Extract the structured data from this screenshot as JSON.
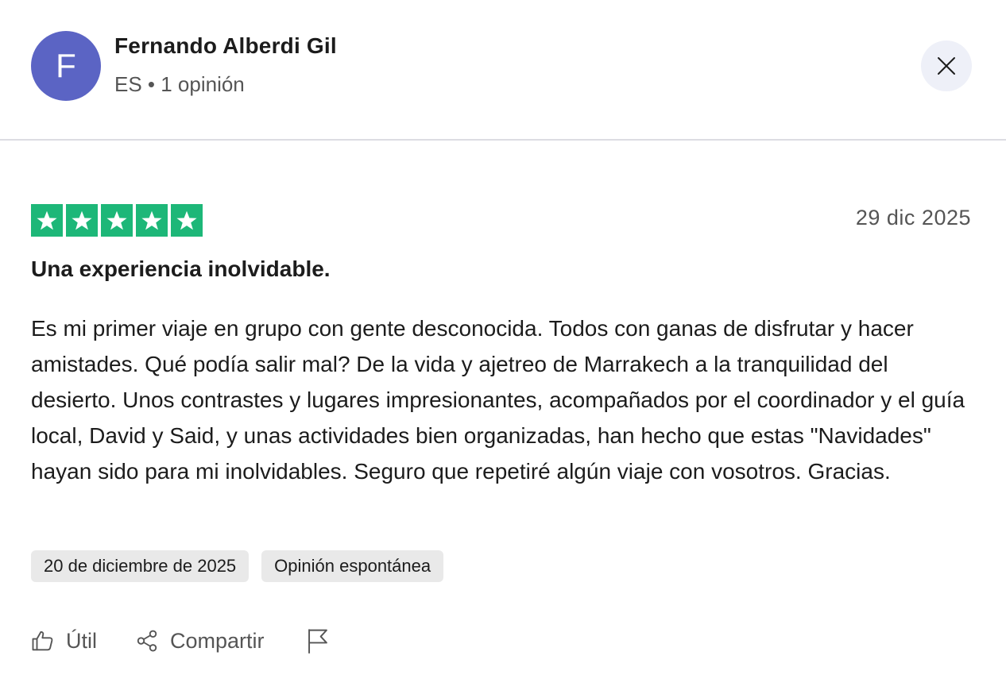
{
  "reviewer": {
    "initial": "F",
    "name": "Fernando Alberdi Gil",
    "meta": "ES • 1 opinión",
    "avatar_color": "#5b64c4"
  },
  "close_icon": "close-icon",
  "review": {
    "rating": 5,
    "max_rating": 5,
    "star_color": "#1db778",
    "date": "29 dic 2025",
    "title": "Una experiencia inolvidable.",
    "body": "Es mi primer viaje en grupo con gente desconocida. Todos con ganas de disfrutar y hacer amistades. Qué podía salir mal? De la vida y ajetreo de Marrakech a la tranquilidad del desierto. Unos contrastes y lugares impresionantes, acompañados por el coordinador y el guía local, David y Said, y unas actividades bien organizadas, han hecho que estas \"Navidades\" hayan sido para mi inolvidables. Seguro que repetiré algún viaje con vosotros. Gracias.",
    "tags": [
      "20 de diciembre de 2025",
      "Opinión espontánea"
    ]
  },
  "actions": {
    "useful_label": "Útil",
    "share_label": "Compartir",
    "icons": [
      "thumbs-up-icon",
      "share-icon",
      "flag-icon"
    ]
  }
}
